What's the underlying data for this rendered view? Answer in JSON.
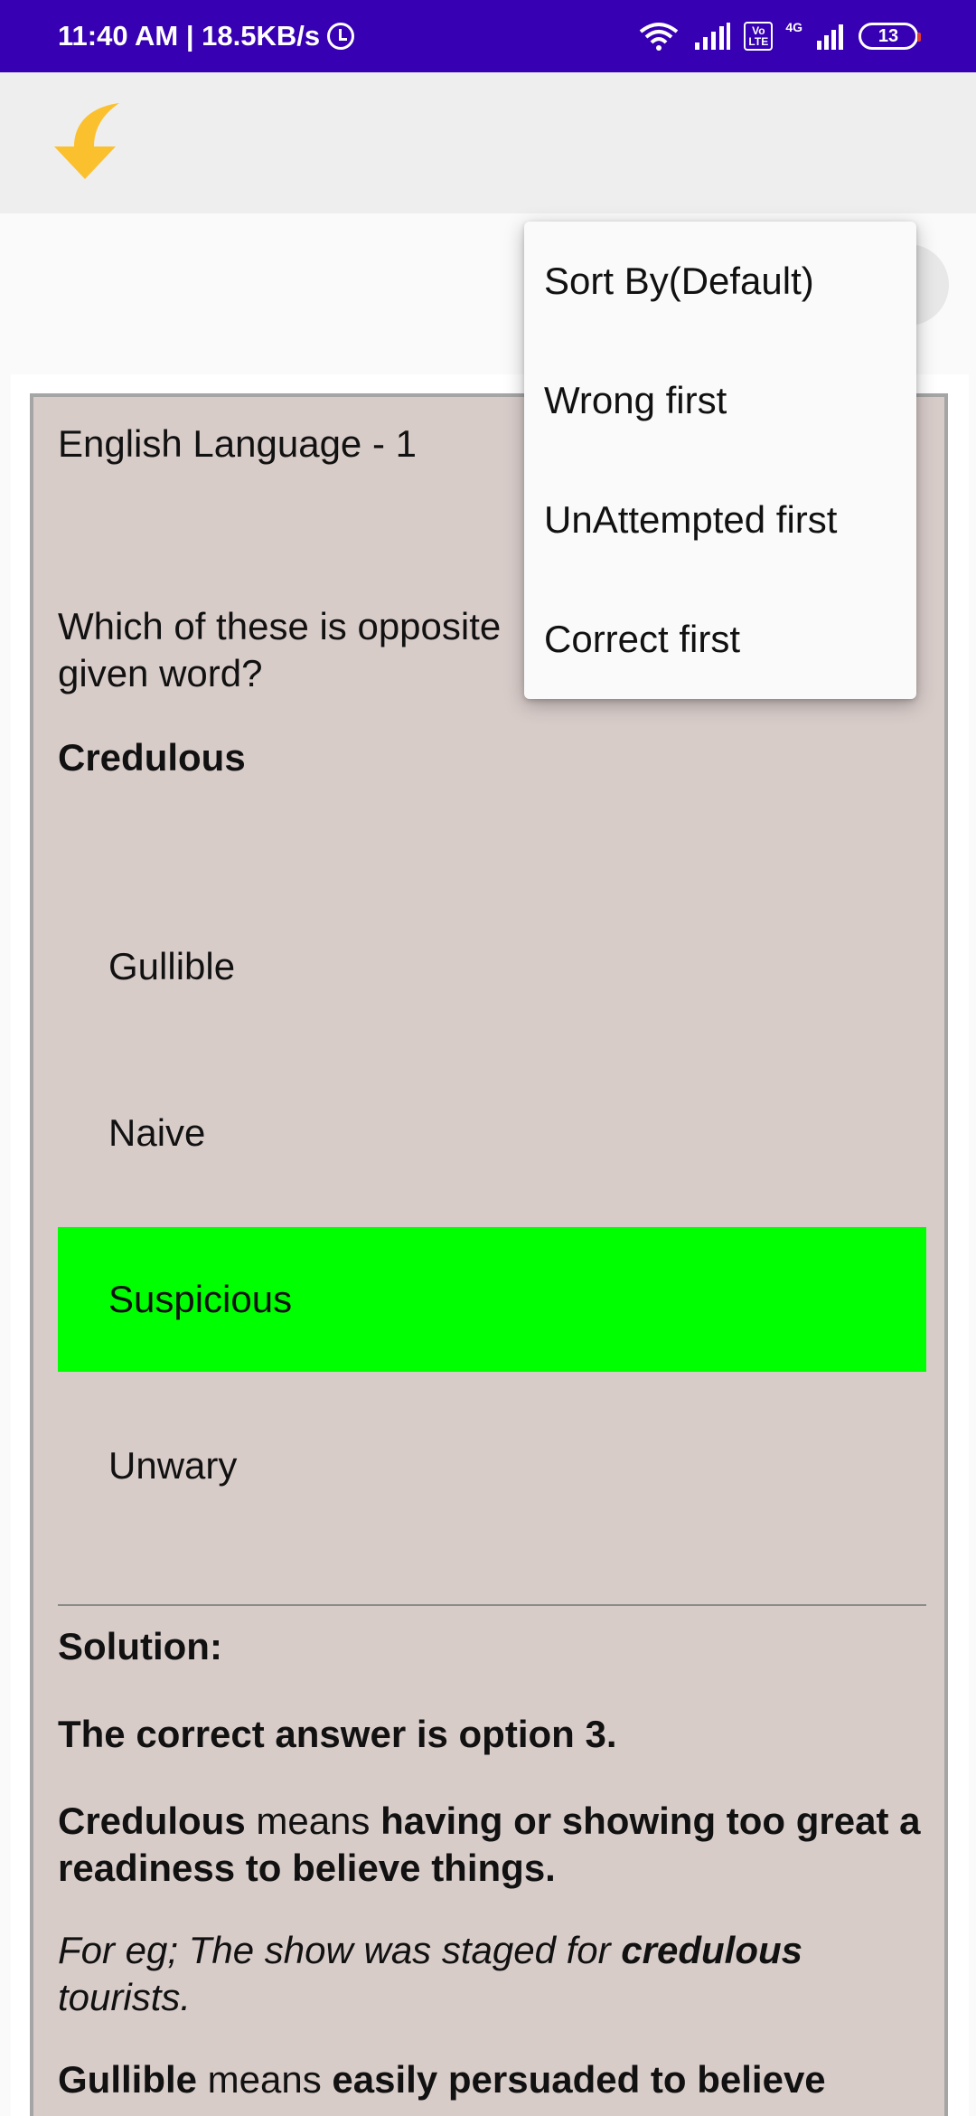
{
  "status_bar": {
    "time_speed": "11:40 AM | 18.5KB/s",
    "volte": "Vo LTE",
    "network": "4G",
    "battery": "13"
  },
  "colors": {
    "status_bar": "#3700b3",
    "app_bar": "#eeeeee",
    "card_bg": "#d8ccc9",
    "correct_option": "#00ff00",
    "back_icon": "#fbc02d"
  },
  "icons": {
    "back": "back-arrow-icon",
    "alarm": "alarm-icon",
    "wifi": "wifi-icon",
    "signal": "signal-icon",
    "battery": "battery-icon"
  },
  "question": {
    "section": "English Language - 1",
    "text": "Which of these is opposite ",
    "text_cont": "given word?",
    "keyword": "Credulous",
    "options": [
      "Gullible",
      "Naive",
      "Suspicious",
      "Unwary"
    ],
    "correct_index": 2
  },
  "solution": {
    "title": "Solution:",
    "answer": "The correct answer is option 3.",
    "p1_word": "Credulous",
    "p1_mid": " means ",
    "p1_def": "having or showing too great a readiness to believe things.",
    "p2_pre": "For eg; The show was staged for ",
    "p2_word": "credulous",
    "p2_post": " tourists.",
    "p3_word": "Gullible",
    "p3_mid": " means ",
    "p3_def": "easily persuaded to believe"
  },
  "menu": {
    "items": [
      "Sort By(Default)",
      "Wrong first",
      "UnAttempted first",
      "Correct first"
    ]
  }
}
